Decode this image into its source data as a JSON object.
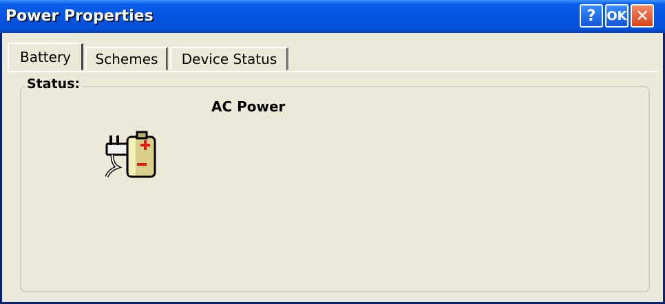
{
  "window": {
    "title": "Power Properties",
    "help_label": "?",
    "ok_label": "OK",
    "close_label": "✕"
  },
  "tabs": [
    {
      "label": "Battery",
      "active": true
    },
    {
      "label": "Schemes",
      "active": false
    },
    {
      "label": "Device Status",
      "active": false
    }
  ],
  "status": {
    "group_label": "Status:",
    "value": "AC Power",
    "icon": "ac-power-battery-icon"
  },
  "colors": {
    "titlebar": "#0554e3",
    "close_button": "#d8431a",
    "background": "#ece9d8"
  }
}
